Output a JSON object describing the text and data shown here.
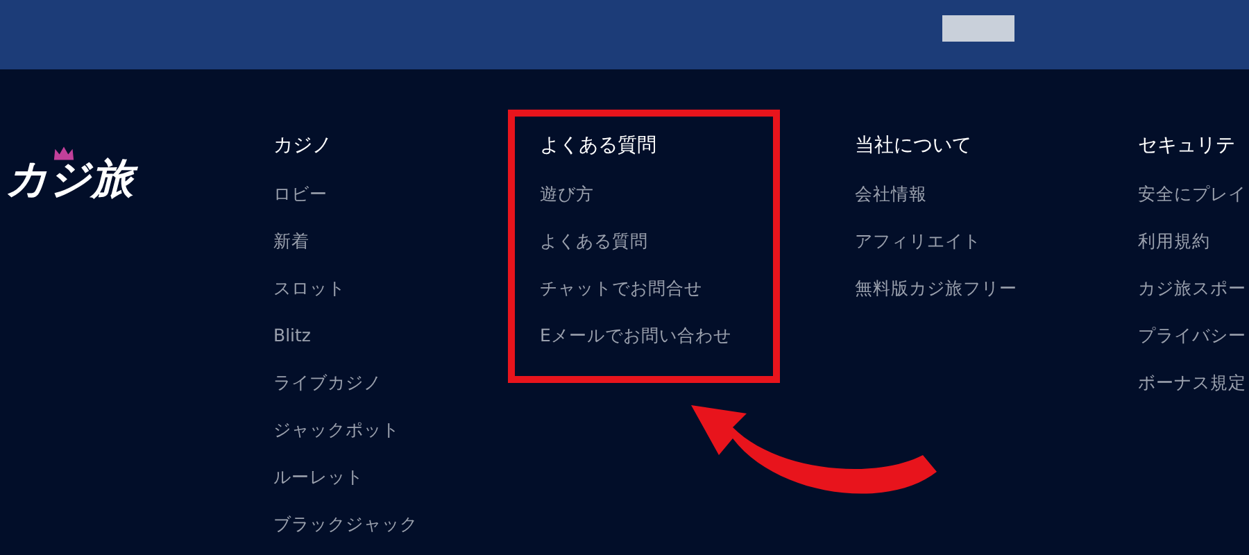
{
  "header": {
    "button": {
      "kind": "blank"
    }
  },
  "logo": {
    "text": "カジ旅"
  },
  "columns": [
    {
      "heading": "カジノ",
      "items": [
        "ロビー",
        "新着",
        "スロット",
        "Blitz",
        "ライブカジノ",
        "ジャックポット",
        "ルーレット",
        "ブラックジャック"
      ]
    },
    {
      "heading": "よくある質問",
      "items": [
        "遊び方",
        "よくある質問",
        "チャットでお問合せ",
        "Eメールでお問い合わせ"
      ],
      "highlighted": true
    },
    {
      "heading": "当社について",
      "items": [
        "会社情報",
        "アフィリエイト",
        "無料版カジ旅フリー"
      ]
    },
    {
      "heading": "セキュリテ",
      "items": [
        "安全にプレイ",
        "利用規約",
        "カジ旅スポー",
        "プライバシー",
        "ボーナス規定"
      ]
    }
  ]
}
